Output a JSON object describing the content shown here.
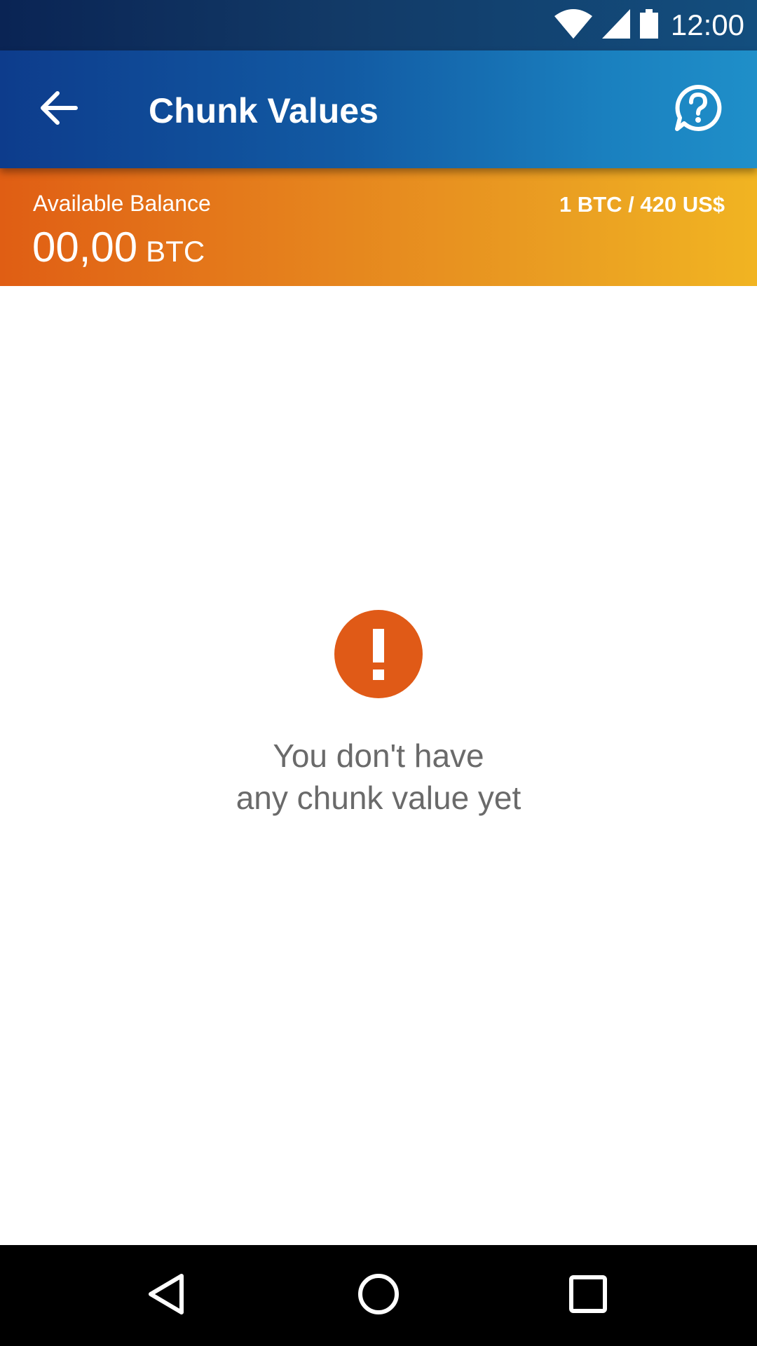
{
  "status_bar": {
    "time": "12:00",
    "icons": [
      "wifi-icon",
      "cellular-signal-icon",
      "battery-icon"
    ]
  },
  "app_bar": {
    "title": "Chunk Values",
    "back_icon": "arrow-back-icon",
    "help_icon": "help-circle-icon"
  },
  "balance": {
    "label": "Available Balance",
    "value": "00,00",
    "unit": "BTC",
    "exchange_rate": "1 BTC / 420 US$"
  },
  "empty_state": {
    "icon": "exclamation-icon",
    "line1": "You don't have",
    "line2": "any chunk value yet"
  },
  "nav_bar": {
    "icons": [
      "nav-back-icon",
      "nav-home-icon",
      "nav-recents-icon"
    ]
  },
  "colors": {
    "app_bar_start": "#0d3c8c",
    "app_bar_end": "#1f8fc9",
    "banner_start": "#e05e14",
    "banner_end": "#f1b422",
    "alert": "#e05a17",
    "message_text": "#6a6a6a"
  }
}
